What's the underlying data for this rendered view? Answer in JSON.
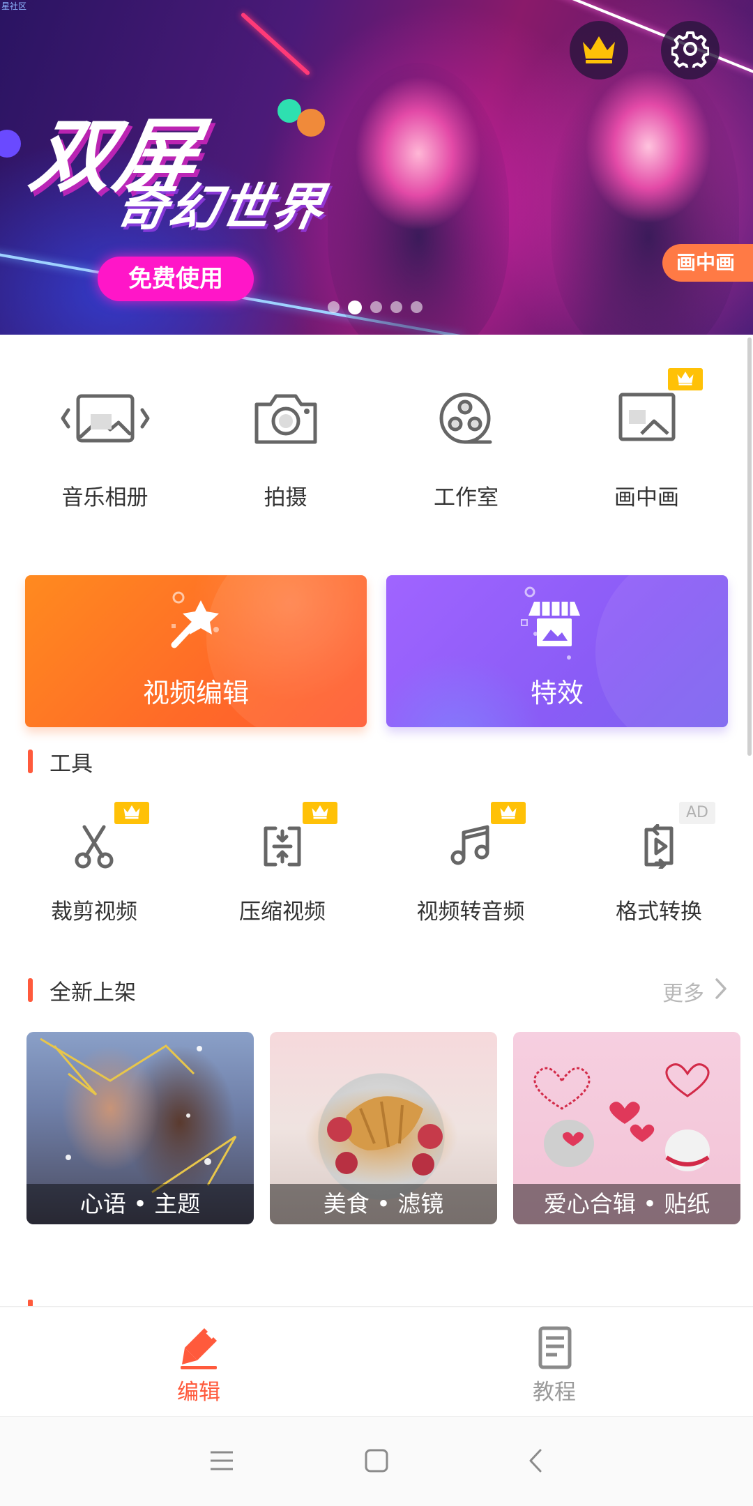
{
  "status": {
    "mini_text": "星社区"
  },
  "banner": {
    "title_main": "双屏",
    "title_sub": "奇幻世界",
    "cta_label": "免费使用",
    "corner_tag": "画中画",
    "dots_count": 5,
    "active_dot": 2,
    "vip_icon": "crown-icon",
    "settings_icon": "gear-icon"
  },
  "features": [
    {
      "label": "音乐相册",
      "icon": "photo-album-icon",
      "vip": false
    },
    {
      "label": "拍摄",
      "icon": "camera-icon",
      "vip": false
    },
    {
      "label": "工作室",
      "icon": "film-reel-icon",
      "vip": false
    },
    {
      "label": "画中画",
      "icon": "picture-in-picture-icon",
      "vip": true
    }
  ],
  "big_cards": {
    "edit": {
      "label": "视频编辑",
      "icon": "magic-wand-icon"
    },
    "fx": {
      "label": "特效",
      "icon": "store-icon"
    }
  },
  "tools_section": {
    "title": "工具",
    "items": [
      {
        "label": "裁剪视频",
        "icon": "scissors-icon",
        "badge": "vip"
      },
      {
        "label": "压缩视频",
        "icon": "compress-icon",
        "badge": "vip"
      },
      {
        "label": "视频转音频",
        "icon": "music-note-icon",
        "badge": "vip"
      },
      {
        "label": "格式转换",
        "icon": "convert-icon",
        "badge": "AD"
      }
    ]
  },
  "new_section": {
    "title": "全新上架",
    "more_label": "更多",
    "tiles": [
      {
        "caption": "心语 • 主题"
      },
      {
        "caption": "美食 • 滤镜"
      },
      {
        "caption": "爱心合辑 • 贴纸"
      }
    ]
  },
  "bottom_nav": {
    "items": [
      {
        "label": "编辑",
        "active": true,
        "icon": "pencil-icon"
      },
      {
        "label": "教程",
        "active": false,
        "icon": "document-icon"
      }
    ]
  },
  "colors": {
    "accent": "#ff5a3c",
    "vip_yellow": "#ffc107",
    "text": "#333333",
    "muted": "#b8b8b8"
  }
}
